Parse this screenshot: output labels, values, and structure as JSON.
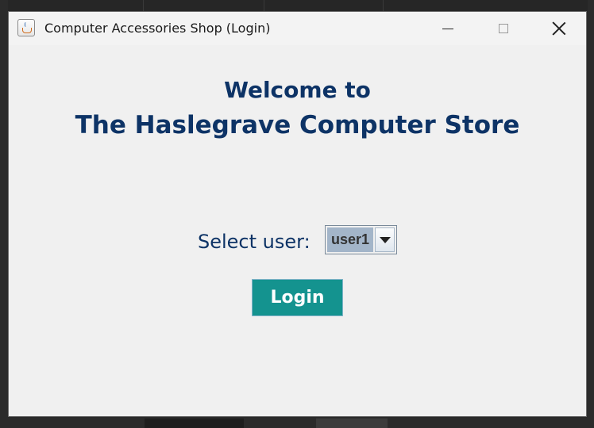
{
  "window": {
    "title": "Computer Accessories Shop (Login)"
  },
  "heading": {
    "line1": "Welcome to",
    "line2": "The Haslegrave Computer Store"
  },
  "form": {
    "select_label": "Select user:",
    "user_select_value": "user1",
    "login_label": "Login"
  },
  "icons": {
    "app": "java-app-icon",
    "minimize": "minimize-icon",
    "maximize": "maximize-icon",
    "close": "close-icon",
    "dropdown": "chevron-down-icon"
  },
  "colors": {
    "heading": "#0d3366",
    "login_button": "#14938f",
    "combo_selected": "#a3b5c9"
  }
}
